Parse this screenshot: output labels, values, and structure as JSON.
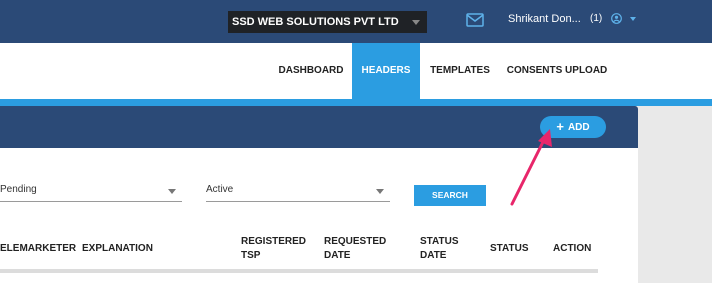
{
  "topbar": {
    "company": "SSD WEB SOLUTIONS PVT LTD",
    "user_name": "Shrikant Don...",
    "notification_count": "(1)",
    "icons": [
      "mail-icon",
      "user-circle-icon",
      "chevron-down-icon"
    ]
  },
  "nav": {
    "items": [
      {
        "label": "DASHBOARD",
        "active": false
      },
      {
        "label": "HEADERS",
        "active": true
      },
      {
        "label": "TEMPLATES",
        "active": false
      },
      {
        "label": "CONSENTS UPLOAD",
        "active": false
      }
    ]
  },
  "panel": {
    "add_label": "ADD"
  },
  "filters": {
    "status_value": "Pending",
    "state_value": "Active",
    "search_label": "SEARCH"
  },
  "table": {
    "headers": [
      {
        "line1": "ELEMARKETER",
        "line2": ""
      },
      {
        "line1": "EXPLANATION",
        "line2": ""
      },
      {
        "line1": "REGISTERED",
        "line2": "TSP"
      },
      {
        "line1": "REQUESTED",
        "line2": "DATE"
      },
      {
        "line1": "STATUS",
        "line2": "DATE"
      },
      {
        "line1": "STATUS",
        "line2": ""
      },
      {
        "line1": "ACTION",
        "line2": ""
      }
    ]
  },
  "colors": {
    "header_navy": "#2b4a77",
    "accent_blue": "#2b9de1",
    "annotation_arrow": "#e8266a"
  }
}
